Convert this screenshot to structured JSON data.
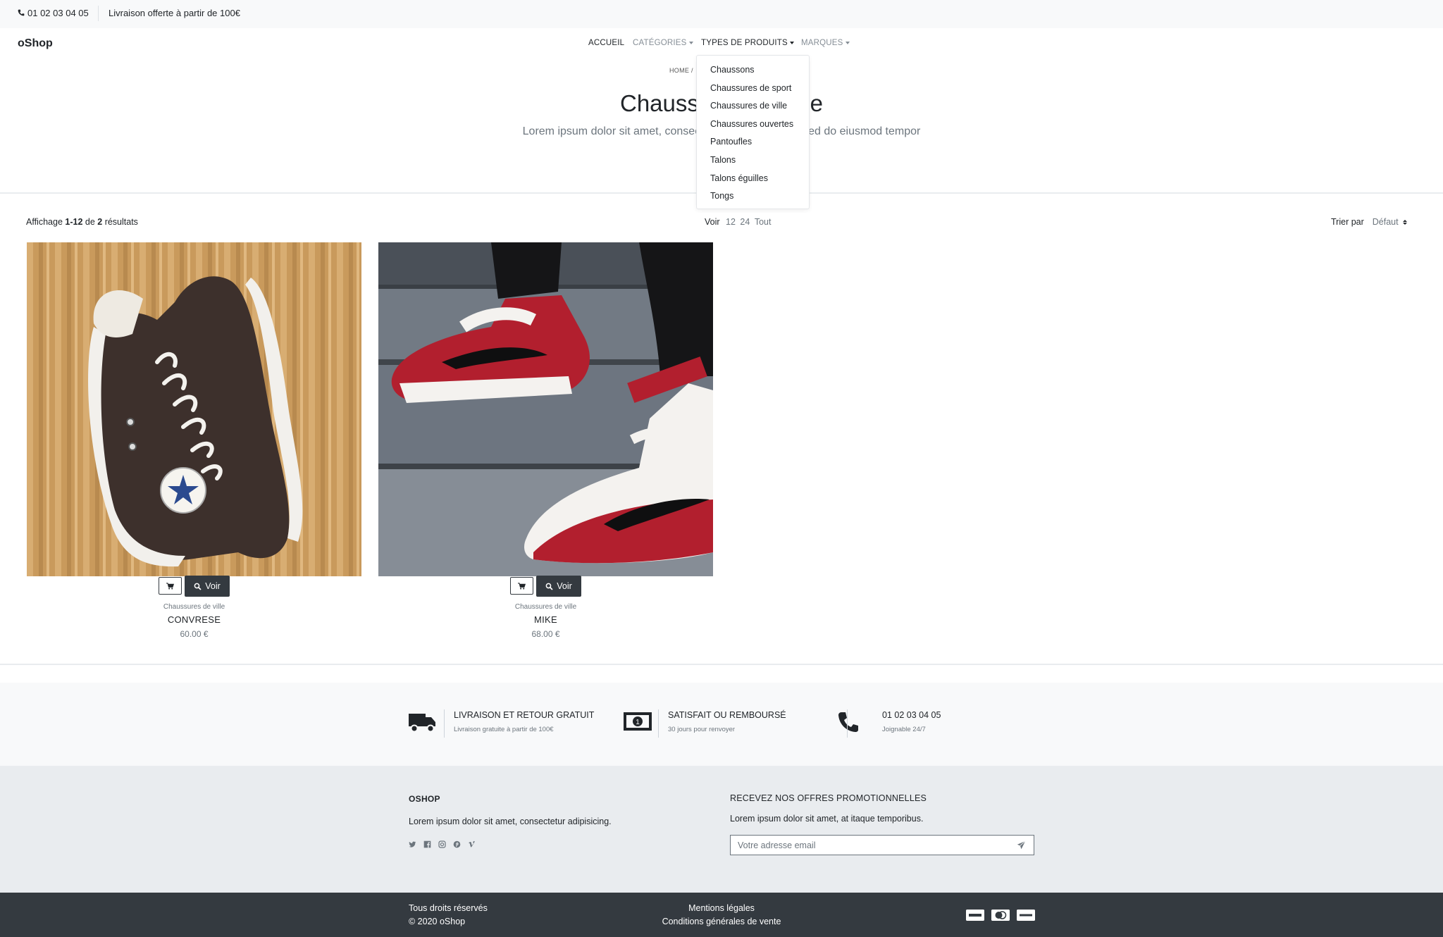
{
  "topbar": {
    "phone": "01 02 03 04 05",
    "shipping": "Livraison offerte à partir de 100€"
  },
  "header": {
    "brand": "oShop",
    "nav": {
      "accueil": "Accueil",
      "categories": "Catégories",
      "types": "Types de produits",
      "marques": "Marques"
    }
  },
  "dropdown": {
    "items": [
      "Chaussons",
      "Chaussures de sport",
      "Chaussures de ville",
      "Chaussures ouvertes",
      "Pantoufles",
      "Talons",
      "Talons éguilles",
      "Tongs"
    ]
  },
  "hero": {
    "breadcrumb": "HOME /",
    "title": "Chaussures de ville",
    "subtitle": "Lorem ipsum dolor sit amet, consectetur adipisicing elit, sed do eiusmod tempor"
  },
  "toolbar": {
    "count_prefix": "Affichage ",
    "count_range": "1-12",
    "count_mid": " de ",
    "count_total": "2",
    "count_suffix": " résultats",
    "per_label": "Voir",
    "per_options": [
      "12",
      "24",
      "Tout"
    ],
    "sort_label": "Trier par",
    "sort_value": "Défaut"
  },
  "products": [
    {
      "type": "Chaussures de ville",
      "name": "CONVRESE",
      "price": "60.00 €",
      "voir": "Voir"
    },
    {
      "type": "Chaussures de ville",
      "name": "MIKE",
      "price": "68.00 €",
      "voir": "Voir"
    }
  ],
  "services": [
    {
      "icon": "truck-icon",
      "title": "Livraison et retour gratuit",
      "subtitle": "Livraison gratuite à partir de 100€"
    },
    {
      "icon": "money-icon",
      "title": "Satisfait ou remboursé",
      "subtitle": "30 jours pour renvoyer"
    },
    {
      "icon": "phone-icon",
      "title": "01 02 03 04 05",
      "subtitle": "Joignable 24/7"
    }
  ],
  "footer": {
    "brand": "OSHOP",
    "description": "Lorem ipsum dolor sit amet, consectetur adipisicing.",
    "socials": [
      "twitter-icon",
      "facebook-icon",
      "instagram-icon",
      "pinterest-icon",
      "vimeo-icon"
    ],
    "promo_title": "Recevez nos offres promotionnelles",
    "promo_desc": "Lorem ipsum dolor sit amet, at itaque temporibus.",
    "email_placeholder": "Votre adresse email"
  },
  "bottom": {
    "rights": "Tous droits réservés",
    "copyright": "© 2020 oShop",
    "mentions": "Mentions légales",
    "cgv": "Conditions générales de vente",
    "payments": [
      "visa-icon",
      "mastercard-icon",
      "paypal-icon"
    ]
  },
  "colors": {
    "dark": "#343a40",
    "light": "#f8f9fa",
    "muted": "#6c757d",
    "footer_bg": "#e9ecef"
  }
}
